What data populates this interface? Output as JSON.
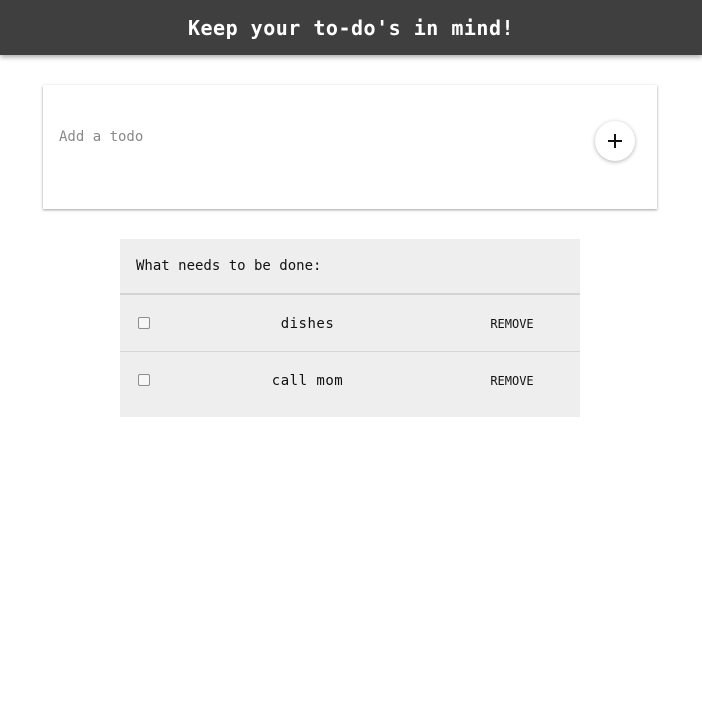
{
  "header": {
    "title": "Keep your to-do's in mind!"
  },
  "add_todo": {
    "placeholder": "Add a todo",
    "value": "",
    "add_icon": "plus-icon"
  },
  "todo_list": {
    "heading": "What needs to be done:",
    "items": [
      {
        "text": "dishes",
        "checked": false,
        "remove_label": "REMOVE"
      },
      {
        "text": "call mom",
        "checked": false,
        "remove_label": "REMOVE"
      }
    ]
  }
}
